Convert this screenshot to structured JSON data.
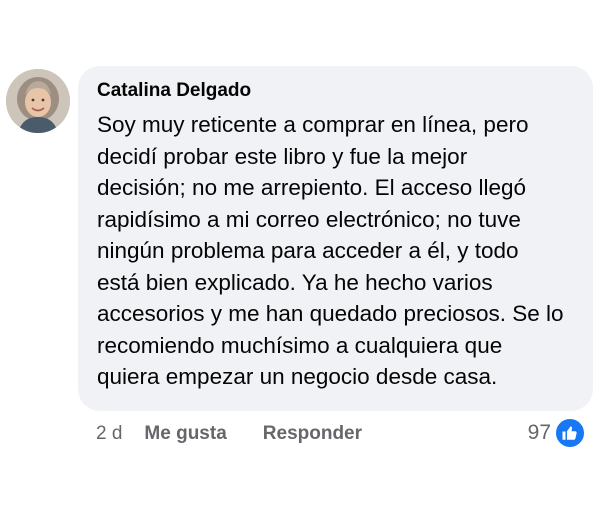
{
  "comment": {
    "author": "Catalina Delgado",
    "text": "Soy muy reticente a comprar en línea, pero\ndecidí probar este libro y fue la mejor\ndecisión; no me arrepiento. El acceso llegó\nrapidísimo a mi correo electrónico; no tuve\nningún problema para acceder a él, y todo\nestá bien explicado. Ya he hecho varios\naccesorios y me han quedado preciosos. Se lo\nrecomiendo muchísimo a cualquiera que\nquiera empezar un negocio desde casa.",
    "timestamp": "2 d",
    "actions": {
      "like_label": "Me gusta",
      "reply_label": "Responder"
    },
    "reactions": {
      "count": "97",
      "icon": "thumbs-up-icon",
      "color": "#1877f2"
    },
    "avatar_icon": "profile-photo"
  }
}
